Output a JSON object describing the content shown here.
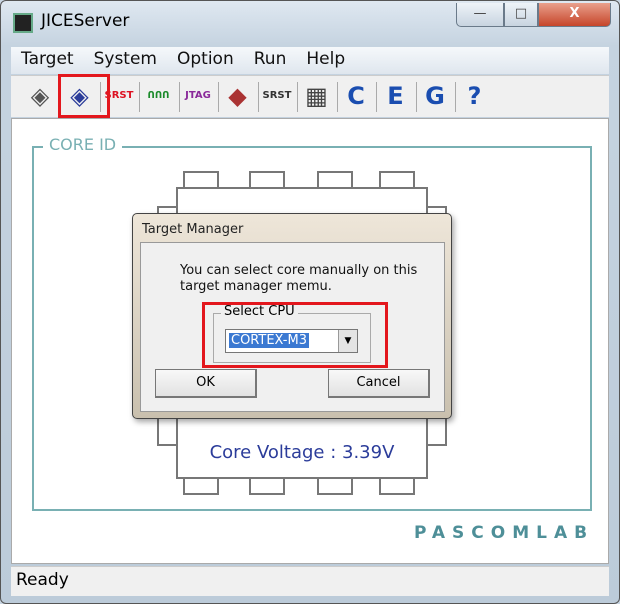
{
  "window": {
    "title": "JICEServer",
    "controls": {
      "minimize": "—",
      "maximize": "□",
      "close": "X"
    }
  },
  "menu": [
    "Target",
    "System",
    "Option",
    "Run",
    "Help"
  ],
  "toolbar": [
    {
      "icon": "target-connect-icon",
      "glyph": "◈",
      "color": "#555"
    },
    {
      "icon": "target-search-icon",
      "glyph": "◈",
      "color": "#2b3c9a"
    },
    {
      "icon": "srst-icon",
      "glyph": "SRST",
      "color": "#d12"
    },
    {
      "icon": "clock-signal-icon",
      "glyph": "ՈՈՈ",
      "color": "#1a8a2a"
    },
    {
      "icon": "jtag-swd-icon",
      "glyph": "JTAG",
      "color": "#8a2a9a"
    },
    {
      "icon": "chip-disconnect-icon",
      "glyph": "◆",
      "color": "#a33"
    },
    {
      "icon": "srst-board-icon",
      "glyph": "SRST",
      "color": "#333"
    },
    {
      "icon": "memory-copy-icon",
      "glyph": "▦",
      "color": "#444"
    },
    {
      "icon": "c-jice-icon",
      "glyph": "C",
      "color": "#1a4db0"
    },
    {
      "icon": "e-jice-icon",
      "glyph": "E",
      "color": "#1a4db0"
    },
    {
      "icon": "g-jice-icon",
      "glyph": "G",
      "color": "#1a4db0"
    },
    {
      "icon": "help-icon",
      "glyph": "?",
      "color": "#1a4db0"
    }
  ],
  "main": {
    "frame_label": "CORE ID",
    "core_voltage": "Core Voltage : 3.39V",
    "brand": "PASCOMLAB"
  },
  "status": "Ready",
  "dialog": {
    "title": "Target Manager",
    "message": "You can select core manually on this target manager memu.",
    "group_label": "Select CPU",
    "cpu_selected": "CORTEX-M3",
    "ok": "OK",
    "cancel": "Cancel"
  },
  "colors": {
    "highlight": "#e3171d",
    "frame": "#79b0b3",
    "voltage": "#2b3c9a"
  }
}
